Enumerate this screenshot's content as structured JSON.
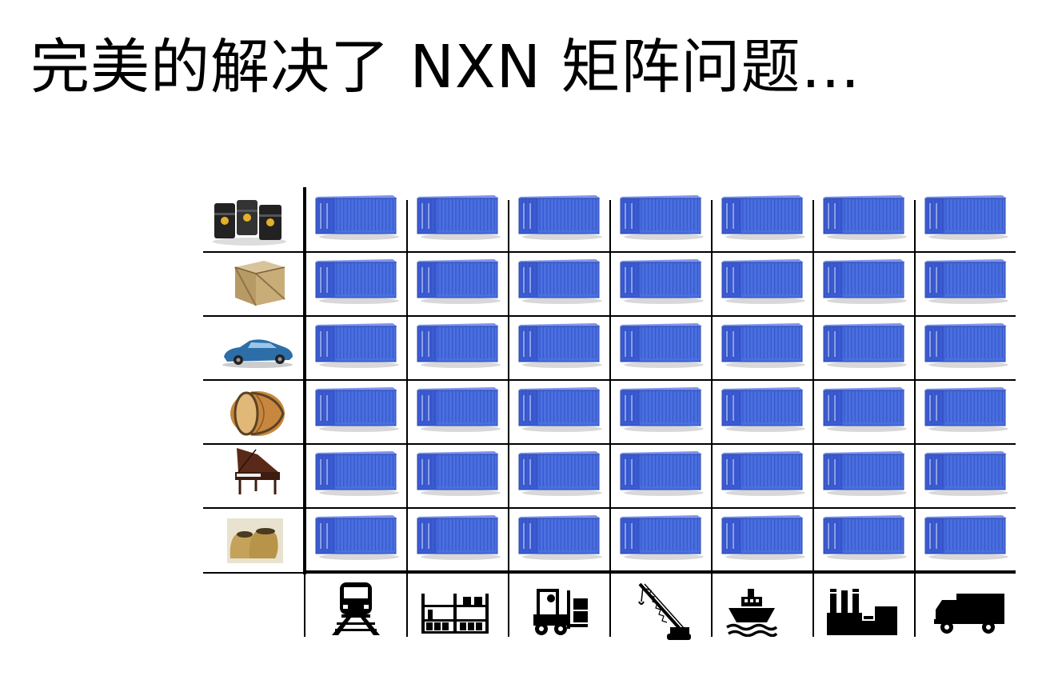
{
  "slide": {
    "title": "完美的解决了 NXN 矩阵问题…"
  },
  "matrix": {
    "rows": [
      {
        "icon": "oil-barrels-icon"
      },
      {
        "icon": "wooden-crate-icon"
      },
      {
        "icon": "sports-car-icon"
      },
      {
        "icon": "wooden-barrel-icon"
      },
      {
        "icon": "grand-piano-icon"
      },
      {
        "icon": "grain-sacks-icon"
      }
    ],
    "columns": [
      {
        "icon": "train-icon"
      },
      {
        "icon": "pallet-rack-icon"
      },
      {
        "icon": "forklift-icon"
      },
      {
        "icon": "crane-icon"
      },
      {
        "icon": "ship-icon"
      },
      {
        "icon": "factory-icon"
      },
      {
        "icon": "truck-icon"
      }
    ],
    "cell_icon": "shipping-container-icon",
    "container_color": "#4a6fe0",
    "line_color": "#000000"
  }
}
